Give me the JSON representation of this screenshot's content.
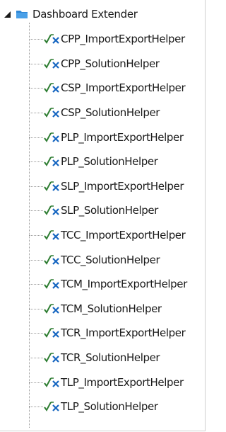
{
  "tree": {
    "root": {
      "label": "Dashboard Extender",
      "expander_icon": "expanded-triangle-icon",
      "folder_icon": "folder-icon"
    },
    "item_icon": "formula-fx-icon",
    "items": [
      {
        "label": "CPP_ImportExportHelper"
      },
      {
        "label": "CPP_SolutionHelper"
      },
      {
        "label": "CSP_ImportExportHelper"
      },
      {
        "label": "CSP_SolutionHelper"
      },
      {
        "label": "PLP_ImportExportHelper"
      },
      {
        "label": "PLP_SolutionHelper"
      },
      {
        "label": "SLP_ImportExportHelper"
      },
      {
        "label": "SLP_SolutionHelper"
      },
      {
        "label": "TCC_ImportExportHelper"
      },
      {
        "label": "TCC_SolutionHelper"
      },
      {
        "label": "TCM_ImportExportHelper"
      },
      {
        "label": "TCM_SolutionHelper"
      },
      {
        "label": "TCR_ImportExportHelper"
      },
      {
        "label": "TCR_SolutionHelper"
      },
      {
        "label": "TLP_ImportExportHelper"
      },
      {
        "label": "TLP_SolutionHelper"
      }
    ]
  },
  "colors": {
    "folder": "#2f87d6",
    "fx_check": "#2e7d32",
    "fx_x": "#1565c0",
    "tree_lines": "#9a9a9a"
  }
}
